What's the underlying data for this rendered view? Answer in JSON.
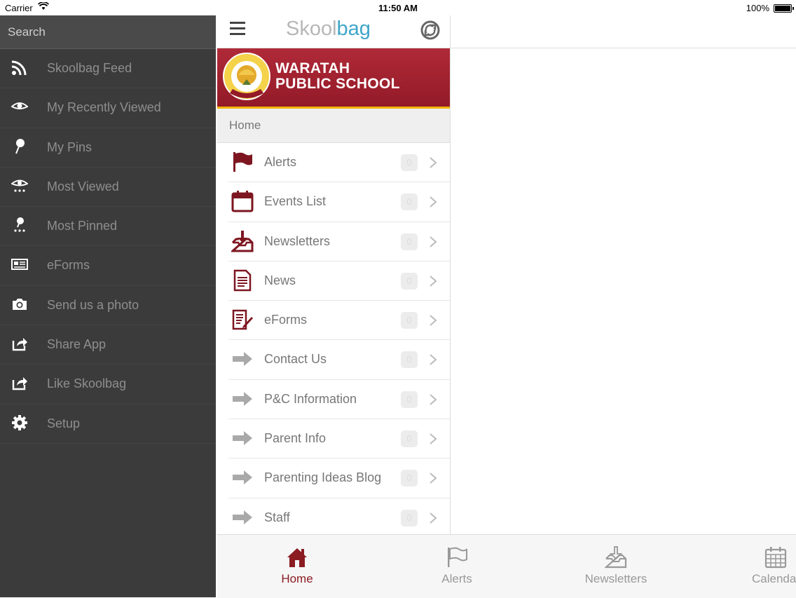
{
  "status_bar": {
    "carrier": "Carrier",
    "time": "11:50 AM",
    "battery": "100%"
  },
  "sidebar": {
    "search_label": "Search",
    "items": [
      {
        "label": "Skoolbag Feed",
        "icon": "rss-icon"
      },
      {
        "label": "My Recently Viewed",
        "icon": "eye-icon"
      },
      {
        "label": "My Pins",
        "icon": "pin-icon"
      },
      {
        "label": "Most Viewed",
        "icon": "eye-dots-icon"
      },
      {
        "label": "Most Pinned",
        "icon": "pin-dots-icon"
      },
      {
        "label": "eForms",
        "icon": "id-card-icon"
      },
      {
        "label": "Send us a photo",
        "icon": "camera-icon"
      },
      {
        "label": "Share App",
        "icon": "share-icon"
      },
      {
        "label": "Like Skoolbag",
        "icon": "share-icon"
      },
      {
        "label": "Setup",
        "icon": "gear-icon"
      }
    ]
  },
  "header": {
    "logo_part1": "Skool",
    "logo_part2": "bag"
  },
  "banner": {
    "line1": "WARATAH",
    "line2": "PUBLIC SCHOOL",
    "crest_text": "WARATAH PUBLIC SCHOOL TRUTH"
  },
  "breadcrumb": "Home",
  "menu": [
    {
      "label": "Alerts",
      "count": "0",
      "icon": "flag-icon"
    },
    {
      "label": "Events List",
      "count": "0",
      "icon": "calendar-icon"
    },
    {
      "label": "Newsletters",
      "count": "0",
      "icon": "inbox-download-icon"
    },
    {
      "label": "News",
      "count": "0",
      "icon": "document-icon"
    },
    {
      "label": "eForms",
      "count": "0",
      "icon": "form-edit-icon"
    },
    {
      "label": "Contact Us",
      "count": "0",
      "icon": "arrow-right-icon"
    },
    {
      "label": "P&C Information",
      "count": "0",
      "icon": "arrow-right-icon"
    },
    {
      "label": "Parent Info",
      "count": "0",
      "icon": "arrow-right-icon"
    },
    {
      "label": "Parenting Ideas Blog",
      "count": "0",
      "icon": "arrow-right-icon"
    },
    {
      "label": "Staff",
      "count": "0",
      "icon": "arrow-right-icon"
    }
  ],
  "tabs": [
    {
      "label": "Home",
      "icon": "home-icon",
      "active": true
    },
    {
      "label": "Alerts",
      "icon": "flag-icon",
      "active": false
    },
    {
      "label": "Newsletters",
      "icon": "inbox-download-icon",
      "active": false
    },
    {
      "label": "Calendar",
      "icon": "calendar-icon",
      "active": false
    }
  ],
  "colors": {
    "brand_red": "#931a28",
    "accent_gold": "#f0b400",
    "logo_blue": "#3ea6c9",
    "sidebar_bg": "#3b3b3b"
  }
}
